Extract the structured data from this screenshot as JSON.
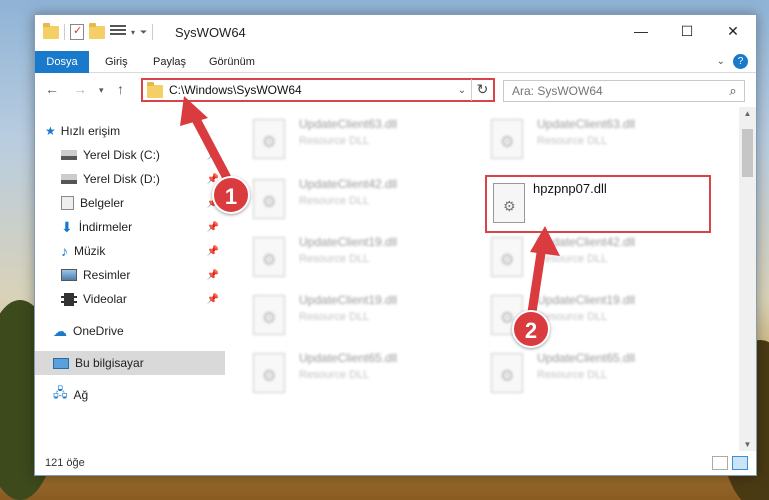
{
  "window": {
    "title": "SysWOW64"
  },
  "ribbon": {
    "tabs": [
      "Dosya",
      "Giriş",
      "Paylaş",
      "Görünüm"
    ]
  },
  "address": {
    "path": "C:\\Windows\\SysWOW64"
  },
  "search": {
    "placeholder": "Ara: SysWOW64"
  },
  "sidebar": {
    "items": [
      {
        "label": "Hızlı erişim",
        "icon": "star-icon"
      },
      {
        "label": "Yerel Disk (C:)",
        "icon": "drive-icon"
      },
      {
        "label": "Yerel Disk (D:)",
        "icon": "drive-icon"
      },
      {
        "label": "Belgeler",
        "icon": "documents-icon"
      },
      {
        "label": "İndirmeler",
        "icon": "download-icon"
      },
      {
        "label": "Müzik",
        "icon": "music-icon"
      },
      {
        "label": "Resimler",
        "icon": "pictures-icon"
      },
      {
        "label": "Videolar",
        "icon": "videos-icon"
      },
      {
        "label": "OneDrive",
        "icon": "cloud-icon"
      },
      {
        "label": "Bu bilgisayar",
        "icon": "computer-icon"
      },
      {
        "label": "Ağ",
        "icon": "network-icon"
      }
    ]
  },
  "files": [
    {
      "name": "UpdateClient63.dll",
      "desc": "Resource DLL"
    },
    {
      "name": "UpdateClient63.dll",
      "desc": "Resource DLL"
    },
    {
      "name": "UpdateClient42.dll",
      "desc": "Resource DLL"
    },
    {
      "name": "hpzpnp07.dll",
      "desc": ""
    },
    {
      "name": "UpdateClient19.dll",
      "desc": "Resource DLL"
    },
    {
      "name": "UpdateClient42.dll",
      "desc": "Resource DLL"
    },
    {
      "name": "UpdateClient19.dll",
      "desc": "Resource DLL"
    },
    {
      "name": "UpdateClient19.dll",
      "desc": "Resource DLL"
    },
    {
      "name": "UpdateClient65.dll",
      "desc": "Resource DLL"
    },
    {
      "name": "UpdateClient65.dll",
      "desc": "Resource DLL"
    }
  ],
  "status": {
    "count": "121 öğe"
  },
  "annotations": {
    "step1": "1",
    "step2": "2",
    "color": "#d93b3f"
  }
}
